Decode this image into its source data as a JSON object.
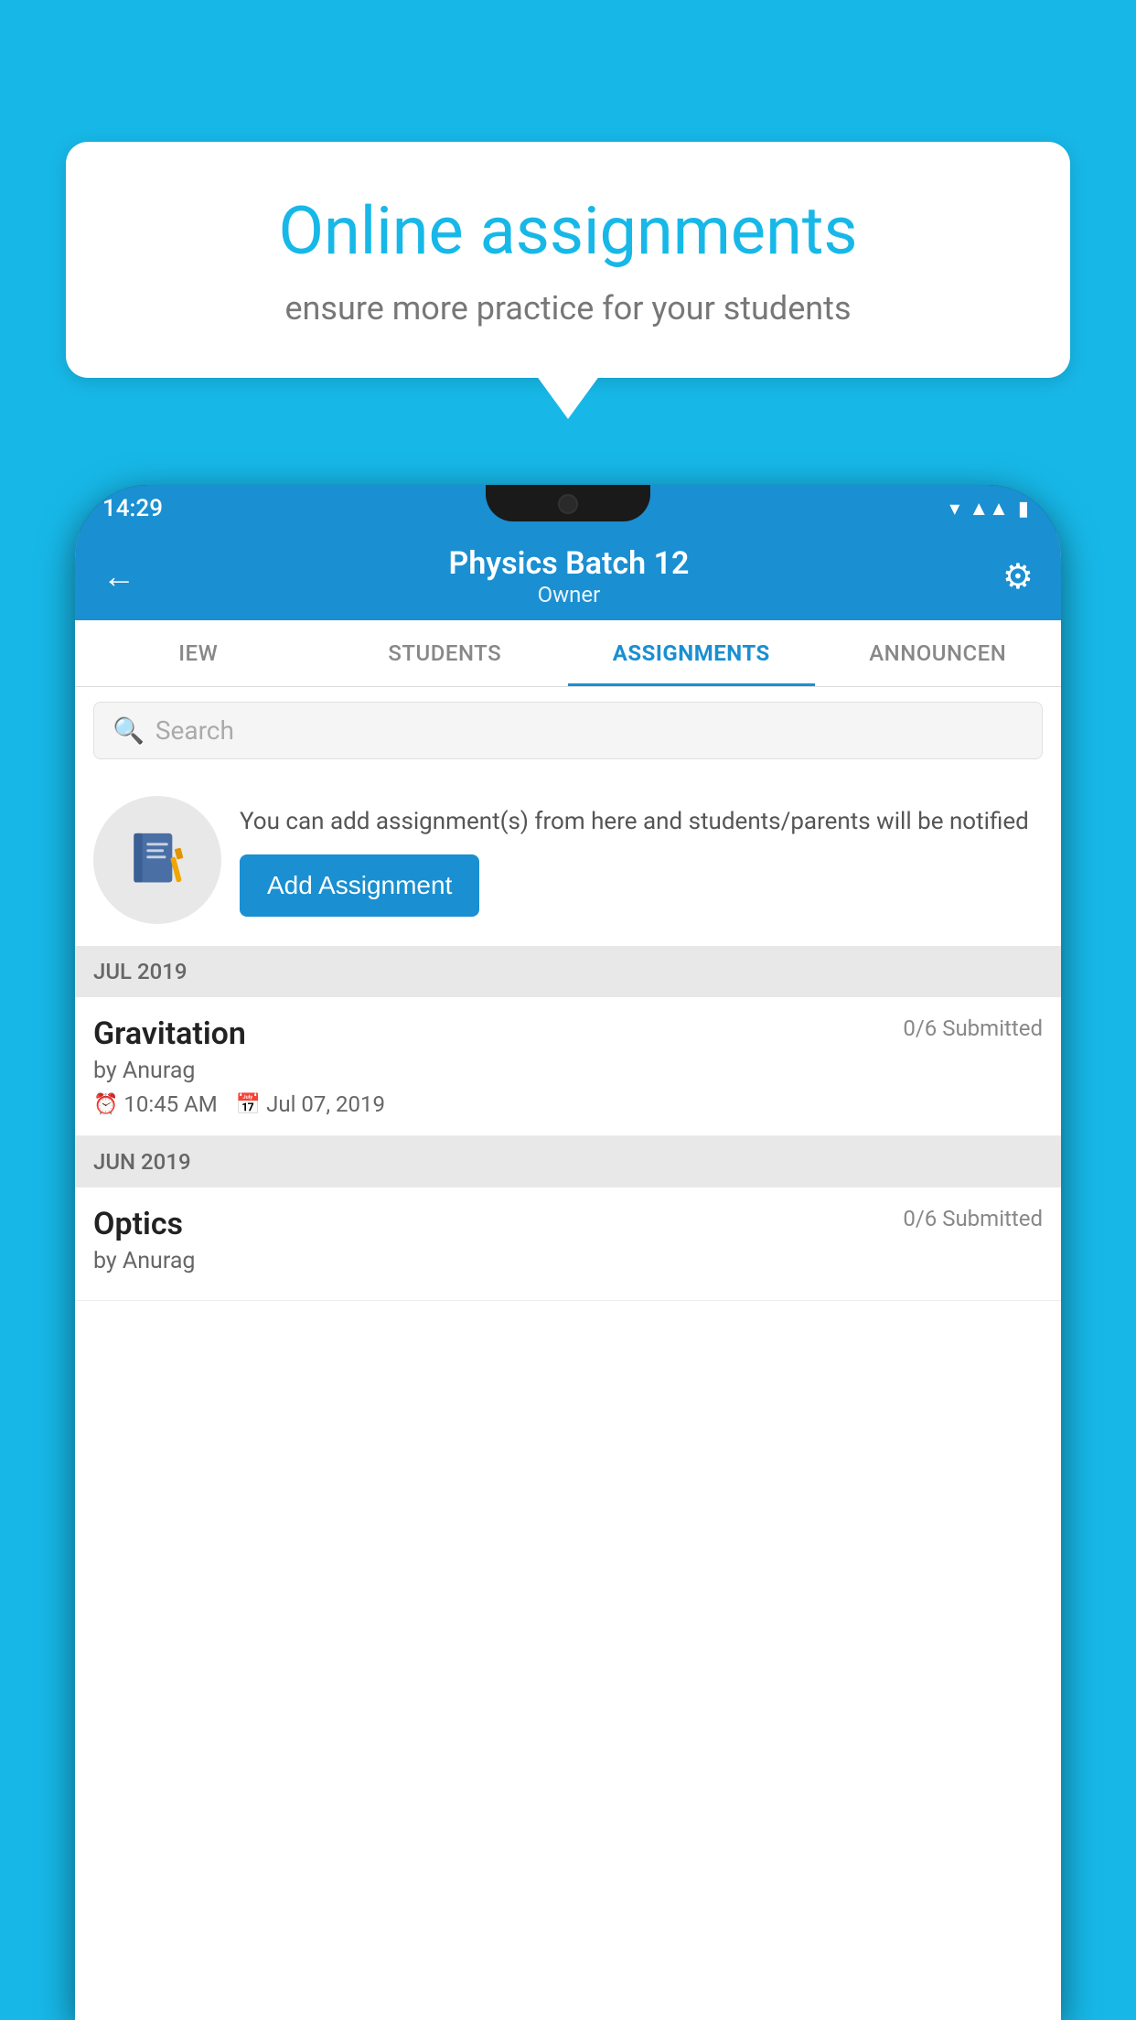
{
  "background_color": "#17b8e8",
  "speech_bubble": {
    "title": "Online assignments",
    "subtitle": "ensure more practice for your students"
  },
  "status_bar": {
    "time": "14:29",
    "icons": [
      "wifi",
      "signal",
      "battery"
    ]
  },
  "header": {
    "title": "Physics Batch 12",
    "subtitle": "Owner",
    "back_label": "←",
    "settings_label": "⚙"
  },
  "tabs": [
    {
      "label": "IEW",
      "active": false
    },
    {
      "label": "STUDENTS",
      "active": false
    },
    {
      "label": "ASSIGNMENTS",
      "active": true
    },
    {
      "label": "ANNOUNCEN",
      "active": false
    }
  ],
  "search": {
    "placeholder": "Search"
  },
  "info_card": {
    "description": "You can add assignment(s) from here and students/parents will be notified",
    "button_label": "Add Assignment"
  },
  "sections": [
    {
      "header": "JUL 2019",
      "assignments": [
        {
          "name": "Gravitation",
          "submitted": "0/6 Submitted",
          "by": "by Anurag",
          "time": "10:45 AM",
          "date": "Jul 07, 2019"
        }
      ]
    },
    {
      "header": "JUN 2019",
      "assignments": [
        {
          "name": "Optics",
          "submitted": "0/6 Submitted",
          "by": "by Anurag",
          "time": "",
          "date": ""
        }
      ]
    }
  ]
}
